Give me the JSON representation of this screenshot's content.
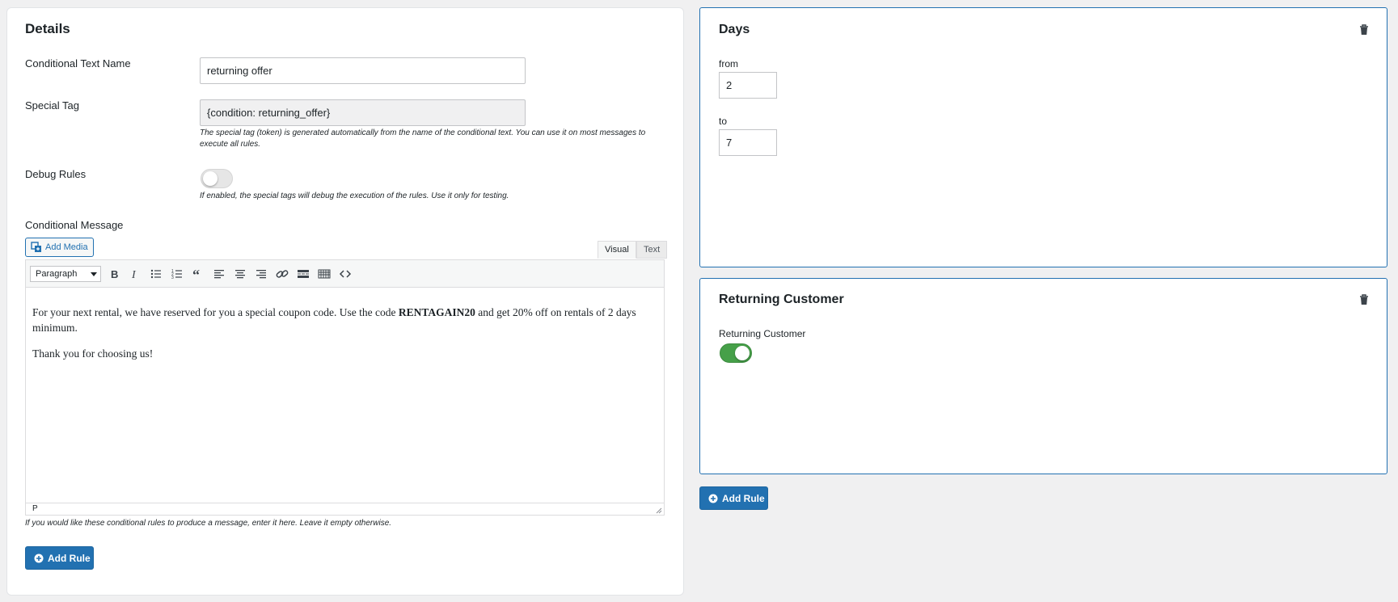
{
  "details": {
    "title": "Details",
    "name_label": "Conditional Text Name",
    "name_value": "returning offer",
    "tag_label": "Special Tag",
    "tag_value": "{condition: returning_offer}",
    "tag_help_line1": "The special tag (token) is generated automatically from the name of the conditional text. You can use it on most messages to",
    "tag_help_line2": "execute all rules.",
    "debug_label": "Debug Rules",
    "debug_enabled": false,
    "debug_help": "If enabled, the special tags will debug the execution of the rules. Use it only for testing.",
    "message_label": "Conditional Message",
    "add_media_label": "Add Media",
    "tab_visual": "Visual",
    "tab_text": "Text",
    "format_value": "Paragraph",
    "toolbar_icons": [
      "bold-icon",
      "italic-icon",
      "bulleted-list-icon",
      "numbered-list-icon",
      "blockquote-icon",
      "align-left-icon",
      "align-center-icon",
      "align-right-icon",
      "link-icon",
      "read-more-icon",
      "toolbar-toggle-icon",
      "code-icon"
    ],
    "message_p1_before": "For your next rental, we have reserved for you a special coupon code. Use the code ",
    "message_p1_bold": "RENTAGAIN20",
    "message_p1_after": " and get 20% off on rentals of 2 days minimum.",
    "message_p2": "Thank you for choosing us!",
    "status_path": "P",
    "message_help": "If you would like these conditional rules to produce a message, enter it here. Leave it empty otherwise.",
    "add_rule_label": "Add Rule"
  },
  "rules": {
    "days": {
      "title": "Days",
      "from_label": "from",
      "from_value": "2",
      "to_label": "to",
      "to_value": "7"
    },
    "returning": {
      "title": "Returning Customer",
      "toggle_label": "Returning Customer",
      "enabled": true
    },
    "add_rule_label": "Add Rule"
  },
  "colors": {
    "accent": "#2271b1",
    "toggle_on": "#46a049",
    "background": "#f0f0f1"
  }
}
